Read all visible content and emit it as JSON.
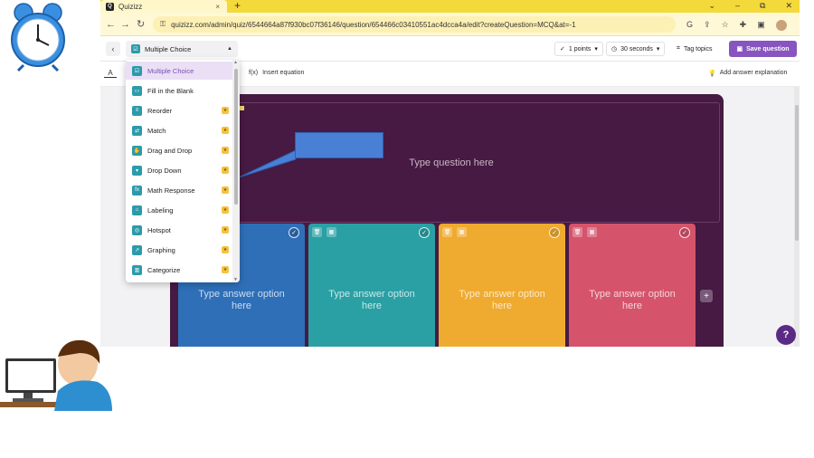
{
  "browser": {
    "tab_title": "Quizizz",
    "tab_close": "×",
    "new_tab": "+",
    "window_controls": [
      "⌄",
      "–",
      "⧉",
      "✕"
    ],
    "url": "quizizz.com/admin/quiz/6544664a87f930bc07f36146/question/654466c03410551ac4dcca4a/edit?createQuestion=MCQ&at=-1"
  },
  "editor_header": {
    "question_type": "Multiple Choice",
    "points": "1 points",
    "time": "30 seconds",
    "tag_topics": "Tag topics",
    "save": "Save question"
  },
  "toolbar": {
    "format_label": "A",
    "insert_equation": "Insert equation",
    "add_explanation": "Add answer explanation"
  },
  "question": {
    "placeholder": "Type question here"
  },
  "answer_options": [
    {
      "text": "Type answer option here",
      "color": "#2e6fb8"
    },
    {
      "text": "Type answer option here",
      "color": "#2aa0a4"
    },
    {
      "text": "Type answer option here",
      "color": "#efaa30"
    },
    {
      "text": "Type answer option here",
      "color": "#d5546b"
    }
  ],
  "type_menu": {
    "items": [
      {
        "label": "Multiple Choice",
        "active": true,
        "pro": false
      },
      {
        "label": "Fill in the Blank",
        "active": false,
        "pro": false
      },
      {
        "label": "Reorder",
        "active": false,
        "pro": true
      },
      {
        "label": "Match",
        "active": false,
        "pro": true
      },
      {
        "label": "Drag and Drop",
        "active": false,
        "pro": true
      },
      {
        "label": "Drop Down",
        "active": false,
        "pro": true
      },
      {
        "label": "Math Response",
        "active": false,
        "pro": true
      },
      {
        "label": "Labeling",
        "active": false,
        "pro": true
      },
      {
        "label": "Hotspot",
        "active": false,
        "pro": true
      },
      {
        "label": "Graphing",
        "active": false,
        "pro": true
      },
      {
        "label": "Categorize",
        "active": false,
        "pro": true
      }
    ]
  },
  "help_label": "?",
  "colors": {
    "brand_purple": "#8854c0",
    "question_card": "#461a42",
    "tabstrip_yellow": "#f4d93a"
  }
}
